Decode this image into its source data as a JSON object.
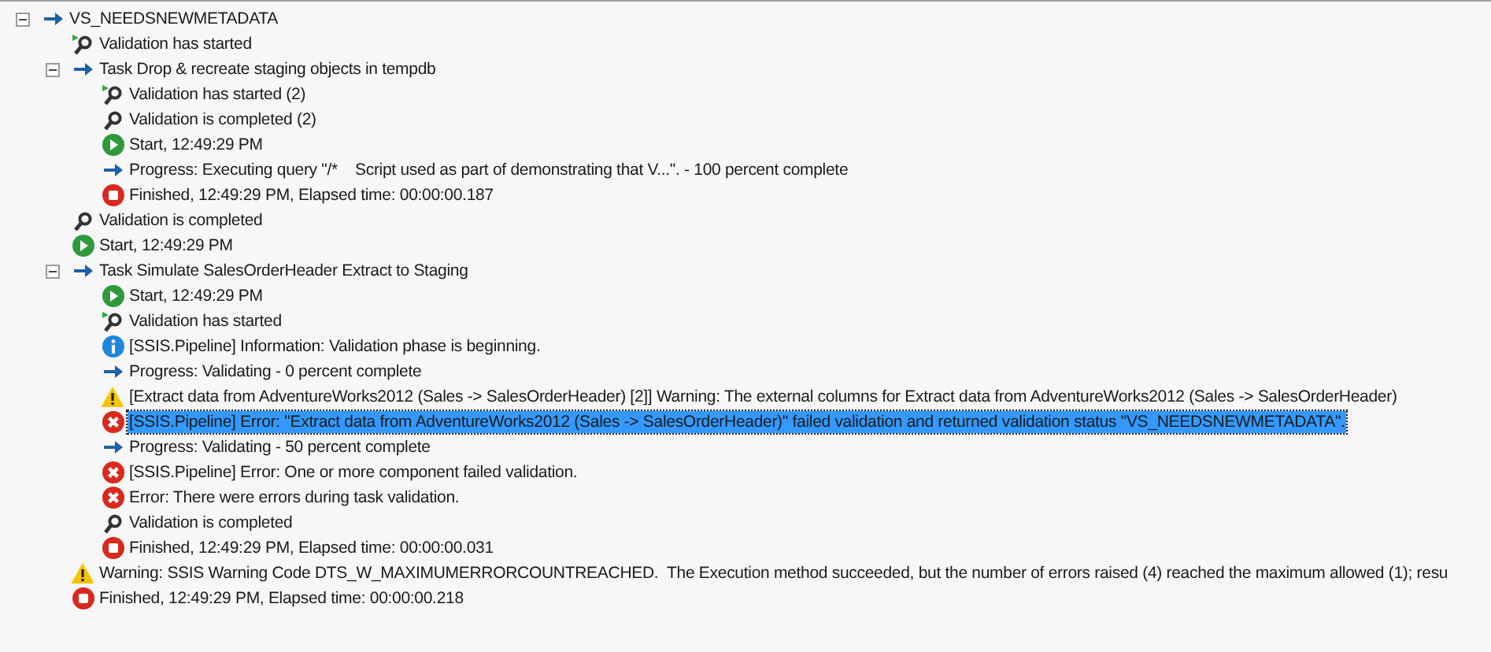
{
  "tree": [
    {
      "kind": "progress",
      "text": "VS_NEEDSNEWMETADATA",
      "expanded": true,
      "selected": false,
      "children": [
        {
          "kind": "validation_started",
          "text": "Validation has started",
          "selected": false
        },
        {
          "kind": "progress",
          "text": "Task Drop & recreate staging objects in tempdb",
          "expanded": true,
          "selected": false,
          "children": [
            {
              "kind": "validation_started",
              "text": "Validation has started (2)",
              "selected": false
            },
            {
              "kind": "validation_completed",
              "text": "Validation is completed (2)",
              "selected": false
            },
            {
              "kind": "start",
              "text": "Start, 12:49:29 PM",
              "selected": false
            },
            {
              "kind": "progress",
              "text": "Progress: Executing query \"/*    Script used as part of demonstrating that V...\". - 100 percent complete",
              "selected": false
            },
            {
              "kind": "finished",
              "text": "Finished, 12:49:29 PM, Elapsed time: 00:00:00.187",
              "selected": false
            }
          ]
        },
        {
          "kind": "validation_completed",
          "text": "Validation is completed",
          "selected": false
        },
        {
          "kind": "start",
          "text": "Start, 12:49:29 PM",
          "selected": false
        },
        {
          "kind": "progress",
          "text": "Task Simulate SalesOrderHeader Extract to Staging",
          "expanded": true,
          "selected": false,
          "children": [
            {
              "kind": "start",
              "text": "Start, 12:49:29 PM",
              "selected": false
            },
            {
              "kind": "validation_started",
              "text": "Validation has started",
              "selected": false
            },
            {
              "kind": "info",
              "text": "[SSIS.Pipeline] Information: Validation phase is beginning.",
              "selected": false
            },
            {
              "kind": "progress",
              "text": "Progress: Validating - 0 percent complete",
              "selected": false
            },
            {
              "kind": "warning",
              "text": "[Extract data from AdventureWorks2012 (Sales -> SalesOrderHeader) [2]] Warning: The external columns for Extract data from AdventureWorks2012 (Sales -> SalesOrderHeader)",
              "selected": false
            },
            {
              "kind": "error",
              "text": "[SSIS.Pipeline] Error: \"Extract data from AdventureWorks2012 (Sales -> SalesOrderHeader)\" failed validation and returned validation status \"VS_NEEDSNEWMETADATA\".",
              "selected": true
            },
            {
              "kind": "progress",
              "text": "Progress: Validating - 50 percent complete",
              "selected": false
            },
            {
              "kind": "error",
              "text": "[SSIS.Pipeline] Error: One or more component failed validation.",
              "selected": false
            },
            {
              "kind": "error",
              "text": "Error: There were errors during task validation.",
              "selected": false
            },
            {
              "kind": "validation_completed",
              "text": "Validation is completed",
              "selected": false
            },
            {
              "kind": "finished",
              "text": "Finished, 12:49:29 PM, Elapsed time: 00:00:00.031",
              "selected": false
            }
          ]
        },
        {
          "kind": "warning",
          "text": "Warning: SSIS Warning Code DTS_W_MAXIMUMERRORCOUNTREACHED.  The Execution method succeeded, but the number of errors raised (4) reached the maximum allowed (1); resu",
          "selected": false
        },
        {
          "kind": "finished",
          "text": "Finished, 12:49:29 PM, Elapsed time: 00:00:00.218",
          "selected": false
        }
      ]
    }
  ]
}
